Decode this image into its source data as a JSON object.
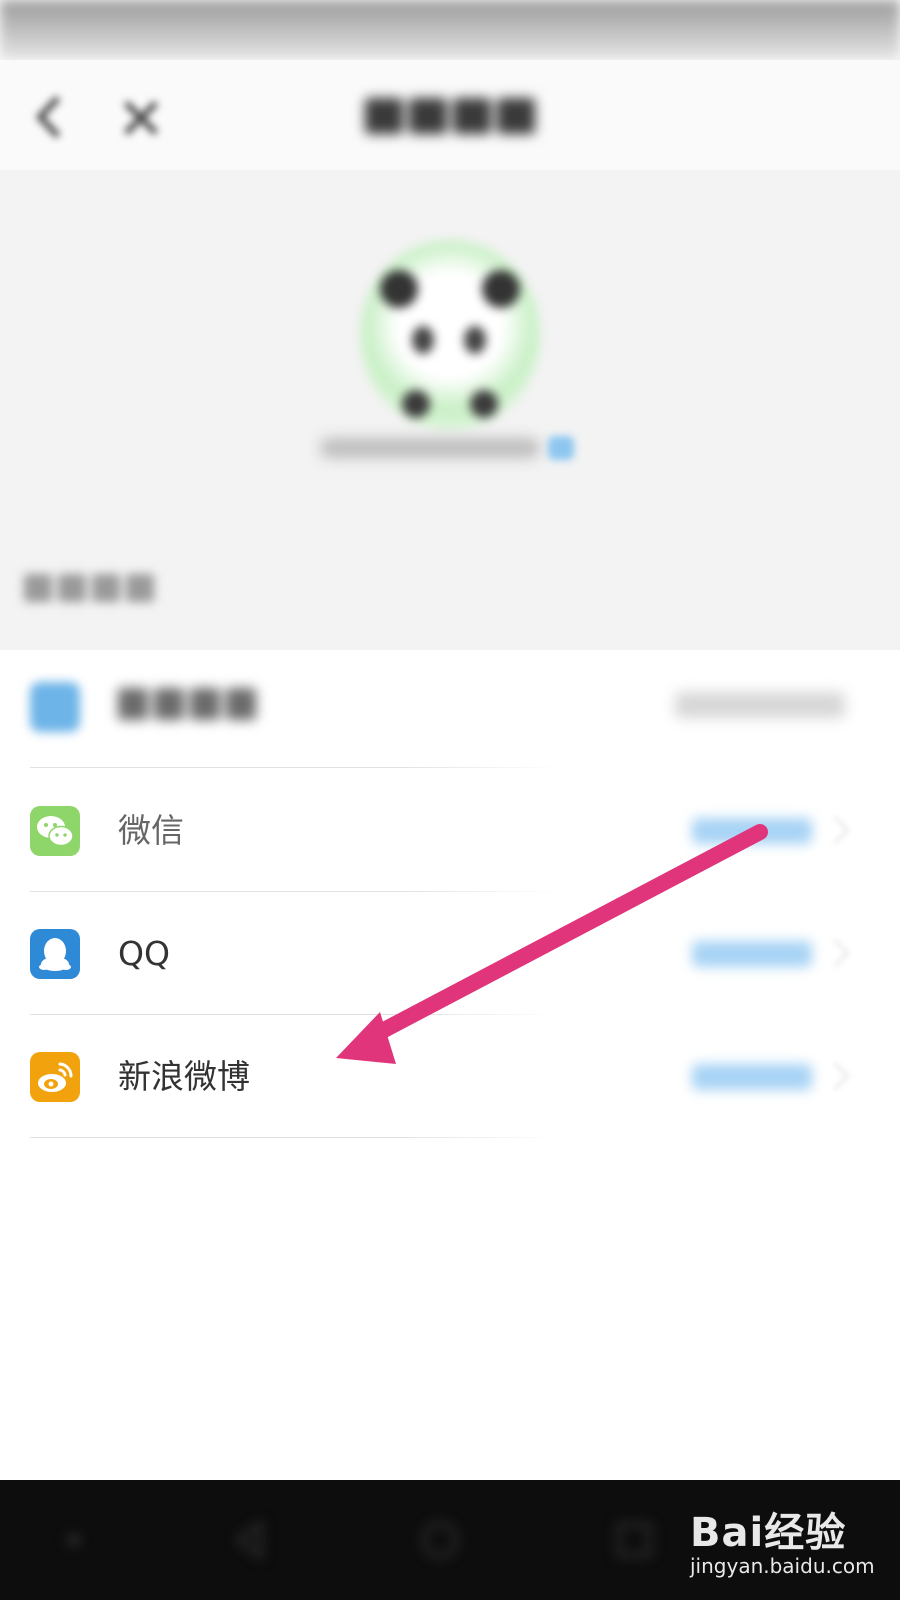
{
  "rows": [
    {
      "label": "微信",
      "icon": "wechat-icon"
    },
    {
      "label": "QQ",
      "icon": "qq-icon"
    },
    {
      "label": "新浪微博",
      "icon": "weibo-icon"
    }
  ],
  "watermark": {
    "logo": "Bai经验",
    "url": "jingyan.baidu.com"
  },
  "colors": {
    "arrow": "#e0357a",
    "wechat": "#8fd66a",
    "qq": "#2e89d6",
    "weibo": "#f2a20c",
    "nav_bar": "#0d0d0d"
  }
}
